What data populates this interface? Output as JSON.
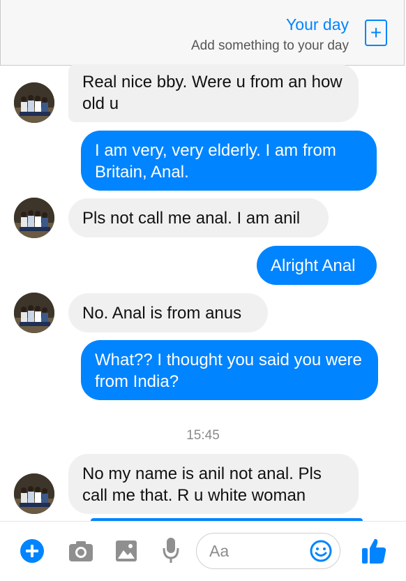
{
  "your_day": {
    "title": "Your day",
    "subtitle": "Add something to your day",
    "add_icon": "plus-square-icon"
  },
  "conversation": {
    "messages": [
      {
        "from": "them",
        "text": "Real nice bby. Were u from an how old u"
      },
      {
        "from": "me",
        "text": "I am very, very elderly. I am from Britain, Anal."
      },
      {
        "from": "them",
        "text": "Pls not call me anal. I am anil"
      },
      {
        "from": "me",
        "text": "Alright Anal"
      },
      {
        "from": "them",
        "text": "No. Anal is from anus"
      },
      {
        "from": "me",
        "text": "What?? I thought you said you were from India?"
      },
      {
        "from": "them",
        "text": "No my name is anil not anal. Pls call me that. R u white woman"
      }
    ],
    "timestamp": "15:45"
  },
  "composer": {
    "placeholder": "Aa",
    "icons": [
      "plus-icon",
      "camera-icon",
      "image-icon",
      "microphone-icon",
      "emoji-icon",
      "thumbs-up-icon"
    ]
  },
  "colors": {
    "accent": "#0084ff",
    "incoming_bubble": "#f1f0f0",
    "outgoing_text": "#ffffff"
  }
}
